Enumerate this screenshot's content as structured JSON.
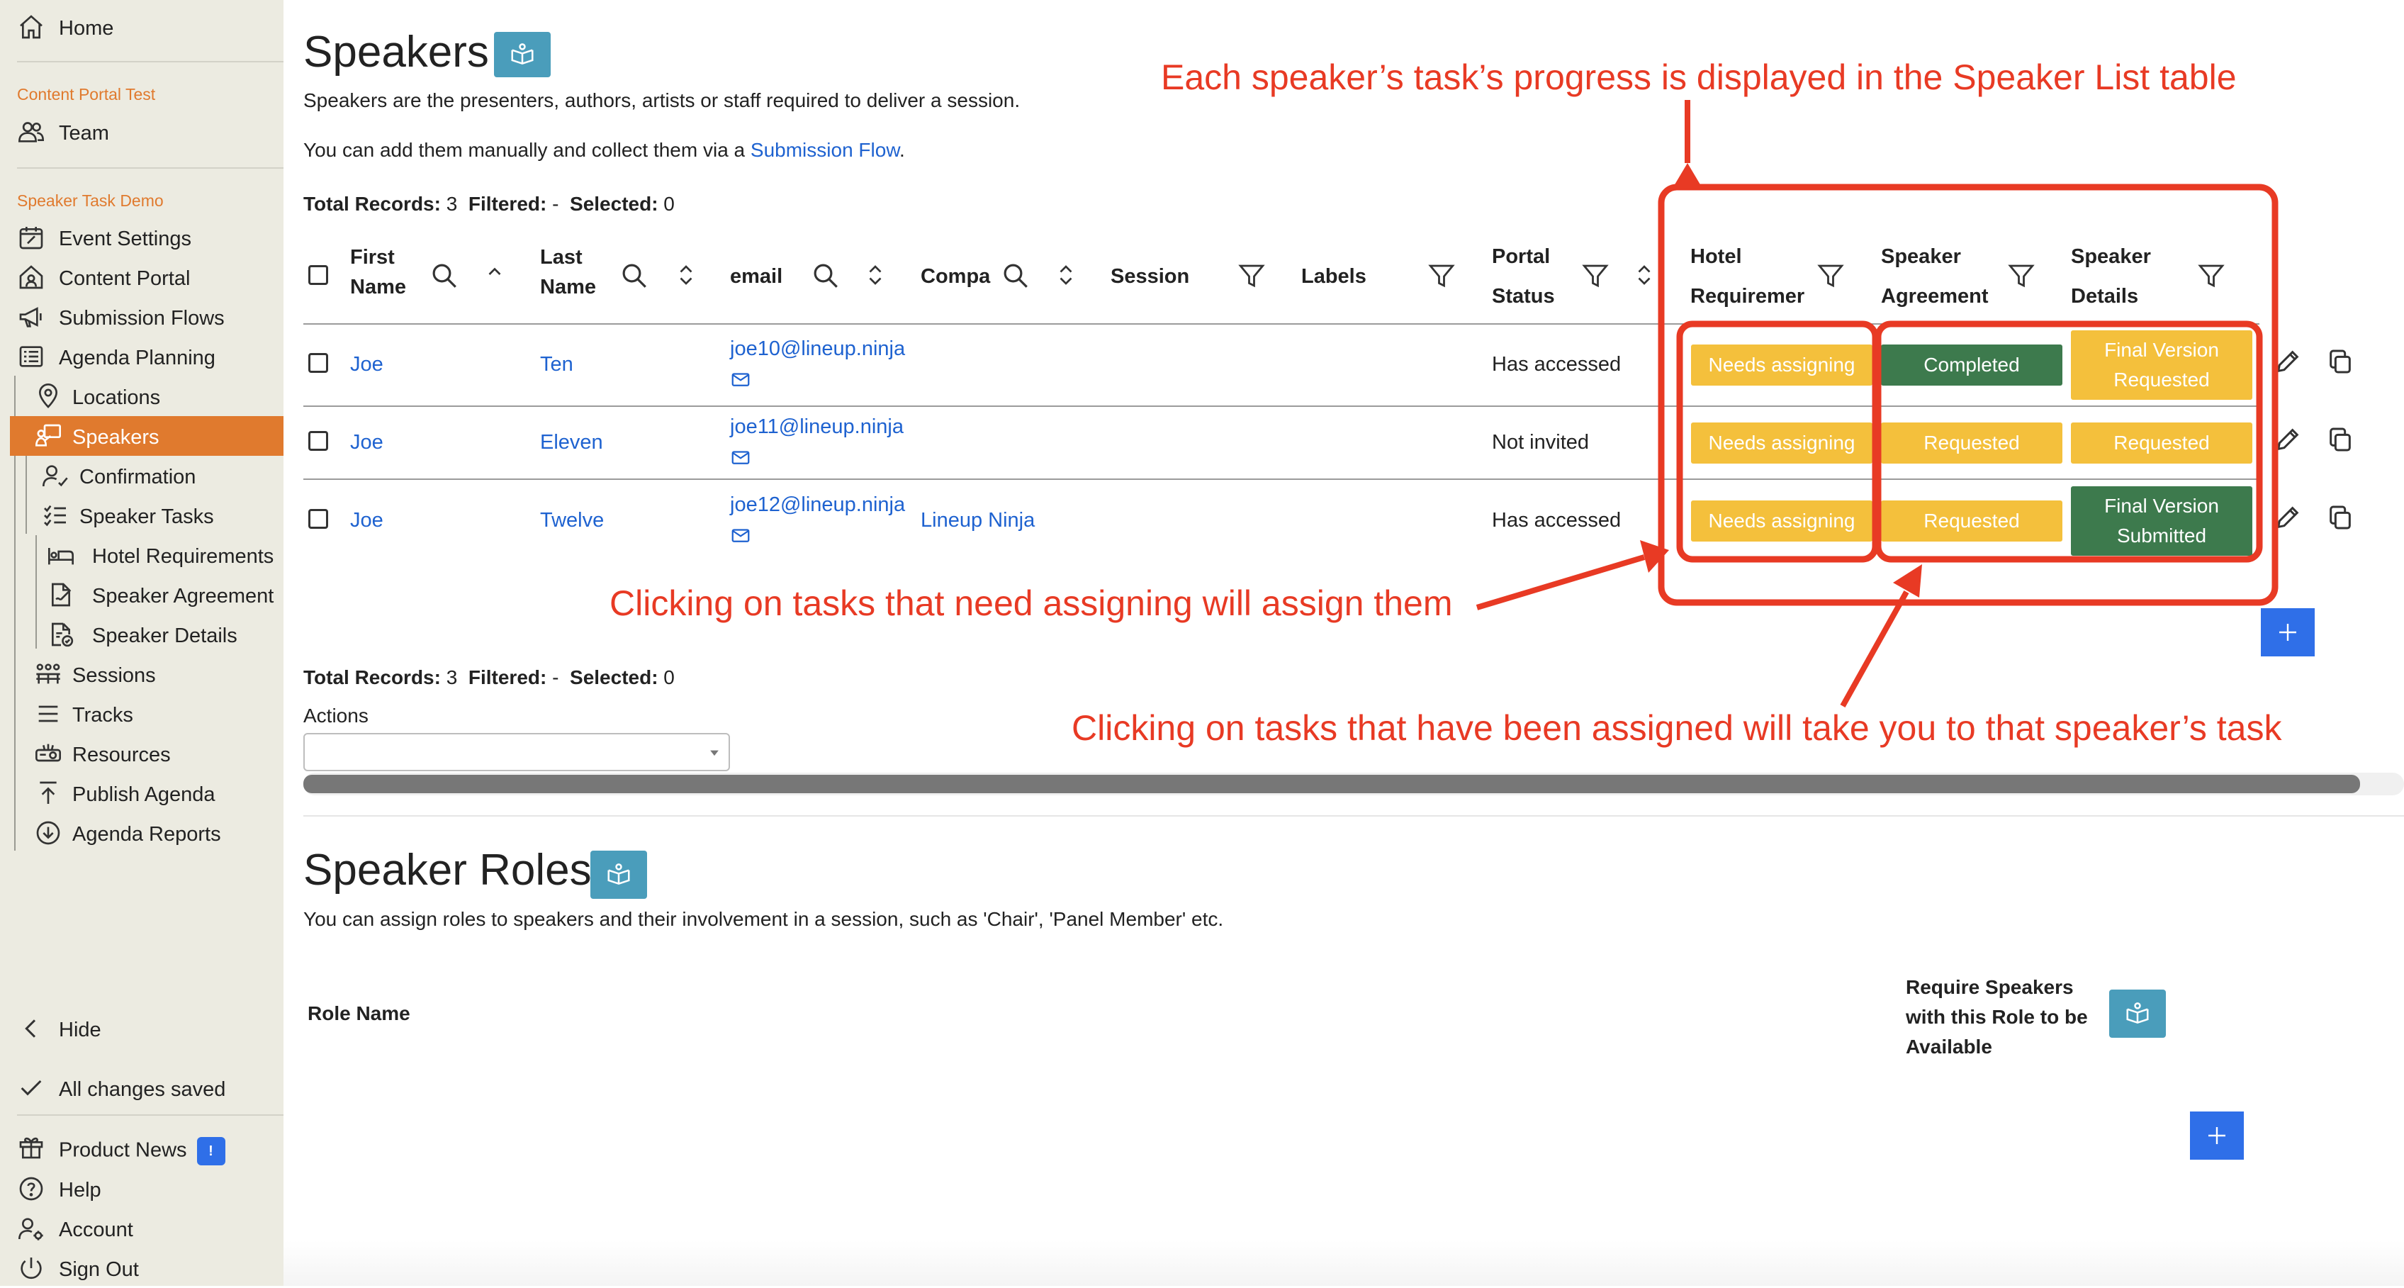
{
  "sidebar": {
    "home": "Home",
    "section1": "Content Portal Test",
    "team": "Team",
    "section2": "Speaker Task Demo",
    "items": {
      "event_settings": "Event Settings",
      "content_portal": "Content Portal",
      "submission_flows": "Submission Flows",
      "agenda_planning": "Agenda Planning",
      "locations": "Locations",
      "speakers": "Speakers",
      "confirmation": "Confirmation",
      "speaker_tasks": "Speaker Tasks",
      "hotel_requirements": "Hotel Requirements",
      "speaker_agreement": "Speaker Agreement",
      "speaker_details": "Speaker Details",
      "sessions": "Sessions",
      "tracks": "Tracks",
      "resources": "Resources",
      "publish_agenda": "Publish Agenda",
      "agenda_reports": "Agenda Reports"
    },
    "hide": "Hide",
    "saved": "All changes saved",
    "product_news": "Product News",
    "news_badge": "!",
    "help": "Help",
    "account": "Account",
    "sign_out": "Sign Out"
  },
  "speakers": {
    "title": "Speakers",
    "desc1": "Speakers are the presenters, authors, artists or staff required to deliver a session.",
    "desc2_pre": "You can add them manually and collect them via a ",
    "desc2_link": "Submission Flow",
    "desc2_post": ".",
    "records": {
      "total_label": "Total Records:",
      "total": "3",
      "filtered_label": "Filtered:",
      "filtered": "-",
      "selected_label": "Selected:",
      "selected": "0"
    },
    "columns": {
      "first_1": "First",
      "first_2": "Name",
      "last_1": "Last",
      "last_2": "Name",
      "email": "email",
      "company": "Compa",
      "session": "Session",
      "labels": "Labels",
      "portal_1": "Portal",
      "portal_2": "Status",
      "hotel_1": "Hotel",
      "hotel_2": "Requiremer",
      "agreement_1": "Speaker",
      "agreement_2": "Agreement",
      "details_1": "Speaker",
      "details_2": "Details"
    },
    "rows": [
      {
        "first": "Joe",
        "last": "Ten",
        "email": "joe10@lineup.ninja",
        "company": "",
        "portal": "Has accessed",
        "hotel": "Needs assigning",
        "agreement": "Completed",
        "details_1": "Final Version",
        "details_2": "Requested"
      },
      {
        "first": "Joe",
        "last": "Eleven",
        "email": "joe11@lineup.ninja",
        "company": "",
        "portal": "Not invited",
        "hotel": "Needs assigning",
        "agreement": "Requested",
        "details_1": "Requested",
        "details_2": ""
      },
      {
        "first": "Joe",
        "last": "Twelve",
        "email": "joe12@lineup.ninja",
        "company": "Lineup Ninja",
        "portal": "Has accessed",
        "hotel": "Needs assigning",
        "agreement": "Requested",
        "details_1": "Final Version",
        "details_2": "Submitted"
      }
    ],
    "actions_label": "Actions",
    "actions_value": ""
  },
  "roles": {
    "title": "Speaker Roles",
    "desc": "You can assign roles to speakers and their involvement in a session, such as 'Chair', 'Panel Member' etc.",
    "col_role": "Role Name",
    "col_req_1": "Require Speakers",
    "col_req_2": "with this Role to be",
    "col_req_3": "Available"
  },
  "annotations": {
    "top": "Each speaker’s task’s progress is displayed in the Speaker List table",
    "middle": "Clicking on tasks that need assigning will assign them",
    "bottom": "Clicking on tasks that have been assigned will take you to that speaker’s task"
  },
  "colors": {
    "accent": "#e07a2e",
    "link": "#1e62d0",
    "yellow": "#f4c03c",
    "green": "#3d7a4d",
    "annotation": "#e83a24",
    "button_blue": "#2f6fe8",
    "book_teal": "#4a9dbb"
  }
}
